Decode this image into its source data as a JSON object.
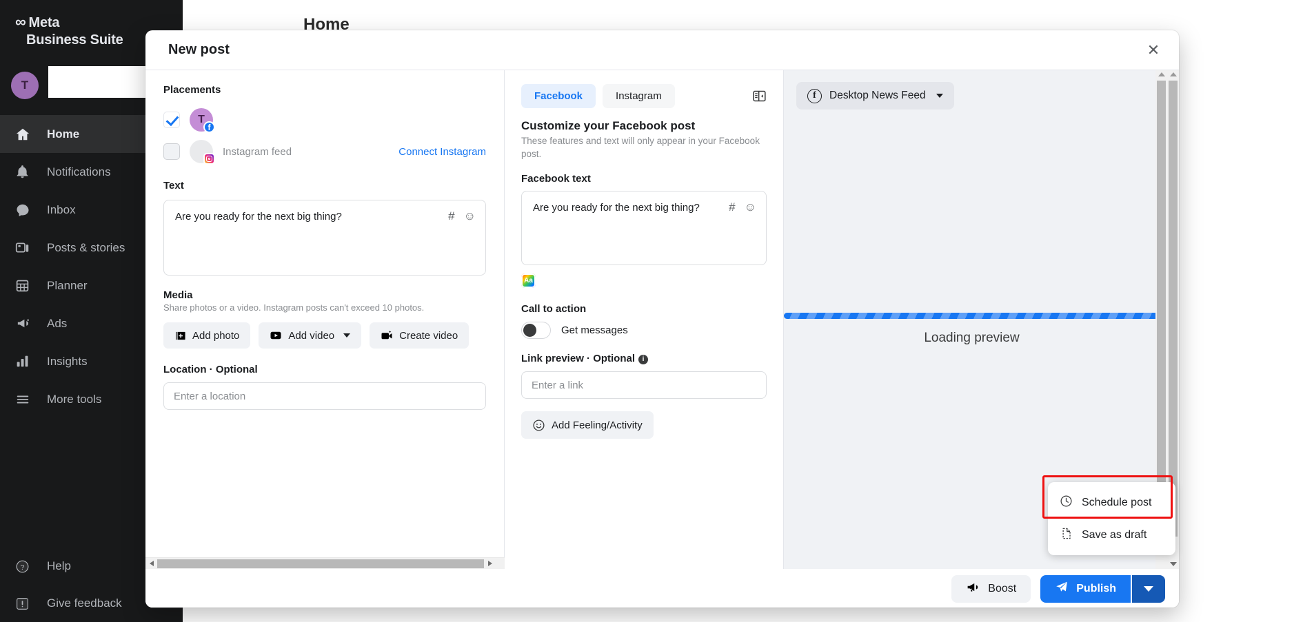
{
  "app": {
    "brand_line1": "Meta",
    "brand_line2": "Business Suite",
    "page_title": "Home",
    "avatar_initial": "T"
  },
  "sidebar": {
    "items": [
      {
        "label": "Home",
        "icon": "home-icon",
        "active": true
      },
      {
        "label": "Notifications",
        "icon": "bell-icon",
        "active": false
      },
      {
        "label": "Inbox",
        "icon": "chat-bubble-icon",
        "active": false
      },
      {
        "label": "Posts & stories",
        "icon": "posts-icon",
        "active": false
      },
      {
        "label": "Planner",
        "icon": "calendar-grid-icon",
        "active": false
      },
      {
        "label": "Ads",
        "icon": "megaphone-icon",
        "active": false
      },
      {
        "label": "Insights",
        "icon": "bar-chart-icon",
        "active": false
      },
      {
        "label": "More tools",
        "icon": "hamburger-icon",
        "active": false
      }
    ],
    "bottom_items": [
      {
        "label": "Help",
        "icon": "question-circle-icon"
      },
      {
        "label": "Give feedback",
        "icon": "exclamation-icon"
      }
    ]
  },
  "modal": {
    "title": "New post",
    "close_label": "✕"
  },
  "left_panel": {
    "placements_label": "Placements",
    "placements": [
      {
        "name": "",
        "network": "facebook",
        "checked": true,
        "avatar_initial": "T"
      },
      {
        "name": "Instagram feed",
        "network": "instagram",
        "checked": false,
        "avatar_initial": ""
      }
    ],
    "connect_instagram_label": "Connect Instagram",
    "text_label": "Text",
    "text_value": "Are you ready for the next big thing?",
    "text_icons": {
      "hashtag": "#",
      "emoji": "☺"
    },
    "media_label": "Media",
    "media_sub": "Share photos or a video. Instagram posts can't exceed 10 photos.",
    "media_buttons": [
      {
        "label": "Add photo",
        "icon": "add-photo-icon",
        "caret": false
      },
      {
        "label": "Add video",
        "icon": "video-icon",
        "caret": true
      },
      {
        "label": "Create video",
        "icon": "create-video-icon",
        "caret": false
      }
    ],
    "location_label": "Location · Optional",
    "location_placeholder": "Enter a location"
  },
  "mid_panel": {
    "tabs": [
      {
        "label": "Facebook",
        "active": true
      },
      {
        "label": "Instagram",
        "active": false
      }
    ],
    "panel_toggle_icon": "split-panel-icon",
    "heading": "Customize your Facebook post",
    "subheading": "These features and text will only appear in your Facebook post.",
    "fb_text_label": "Facebook text",
    "fb_text_value": "Are you ready for the next big thing?",
    "text_icons": {
      "hashtag": "#",
      "emoji": "☺"
    },
    "font_button_label": "Aa",
    "cta_label": "Call to action",
    "cta_toggle_label": "Get messages",
    "cta_toggle_on": false,
    "link_preview_label": "Link preview · Optional",
    "link_info_glyph": "i",
    "link_placeholder": "Enter a link",
    "feeling_button_label": "Add Feeling/Activity",
    "feeling_icon": "smiley-icon"
  },
  "preview_panel": {
    "selected_preview": "Desktop News Feed",
    "preview_icon": "facebook-circle-icon",
    "loading_text": "Loading preview"
  },
  "dropdown": {
    "items": [
      {
        "label": "Schedule post",
        "icon": "clock-icon",
        "highlighted": true
      },
      {
        "label": "Save as draft",
        "icon": "document-icon",
        "highlighted": false
      }
    ]
  },
  "footer": {
    "boost_label": "Boost",
    "boost_icon": "megaphone-icon",
    "publish_label": "Publish",
    "publish_icon": "paper-plane-icon"
  },
  "colors": {
    "accent_blue": "#1877f2",
    "accent_blue_dark": "#1559b5",
    "highlight_red": "#ee1111",
    "sidebar_bg": "#18191a",
    "panel_grey": "#f0f2f5"
  }
}
